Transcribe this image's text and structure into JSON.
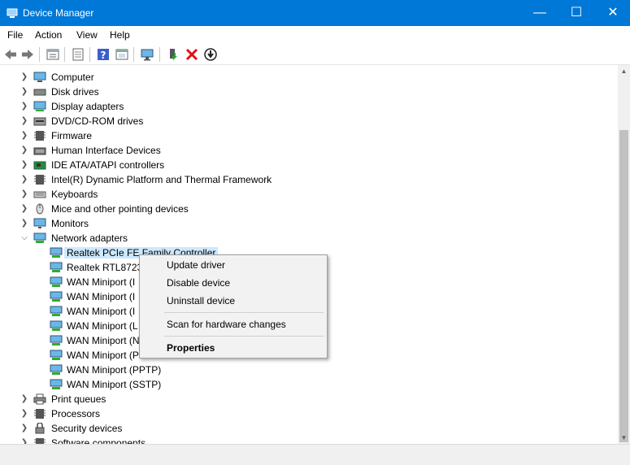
{
  "window": {
    "title": "Device Manager",
    "minimize": "—",
    "maximize": "☐",
    "close": "✕"
  },
  "menu": [
    "File",
    "Action",
    "View",
    "Help"
  ],
  "toolbar": {
    "buttons": [
      "back-icon",
      "forward-icon",
      "properties-view-icon",
      "list-icon",
      "help-icon",
      "details-icon",
      "monitor-scan-icon",
      "enable-driver-icon",
      "uninstall-icon",
      "update-driver-icon"
    ]
  },
  "tree": {
    "categories_top": [
      "Computer",
      "Disk drives",
      "Display adapters",
      "DVD/CD-ROM drives",
      "Firmware",
      "Human Interface Devices",
      "IDE ATA/ATAPI controllers",
      "Intel(R) Dynamic Platform and Thermal Framework",
      "Keyboards",
      "Mice and other pointing devices",
      "Monitors"
    ],
    "network": {
      "label": "Network adapters",
      "children": [
        "Realtek PCIe FE Family Controller",
        "Realtek RTL8723E",
        "WAN Miniport (I",
        "WAN Miniport (I",
        "WAN Miniport (I",
        "WAN Miniport (L",
        "WAN Miniport (N",
        "WAN Miniport (P",
        "WAN Miniport (PPTP)",
        "WAN Miniport (SSTP)"
      ]
    },
    "categories_bottom": [
      "Print queues",
      "Processors",
      "Security devices",
      "Software components"
    ]
  },
  "context_menu": {
    "items": [
      "Update driver",
      "Disable device",
      "Uninstall device",
      "Scan for hardware changes",
      "Properties"
    ]
  },
  "colors": {
    "titlebar": "#0078d7",
    "selection": "#cce8ff"
  }
}
